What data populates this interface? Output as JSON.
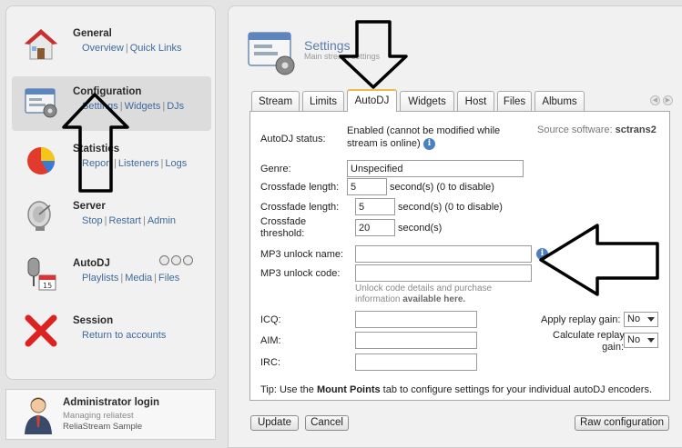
{
  "sidebar": {
    "items": [
      {
        "title": "General",
        "links": [
          "Overview",
          "Quick Links"
        ]
      },
      {
        "title": "Configuration",
        "links": [
          "Settings",
          "Widgets",
          "DJs"
        ]
      },
      {
        "title": "Statistics",
        "links": [
          "Report",
          "Listeners",
          "Logs"
        ]
      },
      {
        "title": "Server",
        "links": [
          "Stop",
          "Restart",
          "Admin"
        ]
      },
      {
        "title": "AutoDJ",
        "links": [
          "Playlists",
          "Media",
          "Files"
        ]
      },
      {
        "title": "Session",
        "links": [
          "Return to accounts"
        ]
      }
    ],
    "login": {
      "title": "Administrator login",
      "managing": "Managing reliatest",
      "product": "ReliaStream Sample"
    }
  },
  "header": {
    "title": "Settings",
    "subtitle": "Main stream settings"
  },
  "tabs": [
    "Stream",
    "Limits",
    "AutoDJ",
    "Widgets",
    "Host",
    "Files",
    "Albums"
  ],
  "active_tab": "AutoDJ",
  "form": {
    "autodj_status_label": "AutoDJ status:",
    "autodj_status_line1": "Enabled (cannot be modified while",
    "autodj_status_line2": "stream is online)",
    "source_software_label": "Source software:",
    "source_software_value": "sctrans2",
    "genre_label": "Genre:",
    "genre_value": "Unspecified",
    "crossfade_length_label": "Crossfade length:",
    "crossfade_length_value": "5",
    "crossfade_length_suffix": "second(s) (0 to disable)",
    "crossfade_length2_label": "Crossfade length:",
    "crossfade_length2_value": "5",
    "crossfade_length2_suffix": "second(s) (0 to disable)",
    "crossfade_threshold_label1": "Crossfade",
    "crossfade_threshold_label2": "threshold:",
    "crossfade_threshold_value": "20",
    "crossfade_threshold_suffix": "second(s)",
    "mp3_unlock_name_label": "MP3 unlock name:",
    "mp3_unlock_name_value": "",
    "mp3_unlock_code_label": "MP3 unlock code:",
    "mp3_unlock_code_value": "",
    "unlock_hint_line1": "Unlock code details and purchase",
    "unlock_hint_line2_prefix": "information ",
    "unlock_hint_line2_link": "available here.",
    "icq_label": "ICQ:",
    "icq_value": "",
    "aim_label": "AIM:",
    "aim_value": "",
    "irc_label": "IRC:",
    "irc_value": "",
    "apply_replay_gain_label": "Apply replay gain:",
    "apply_replay_gain_value": "No",
    "calc_replay_gain_label1": "Calculate replay",
    "calc_replay_gain_label2": "gain:",
    "calc_replay_gain_value": "No",
    "tip_prefix": "Tip: Use the ",
    "tip_bold": "Mount Points",
    "tip_suffix": " tab to configure settings for your individual autoDJ encoders."
  },
  "buttons": {
    "update": "Update",
    "cancel": "Cancel",
    "raw_configuration": "Raw configuration"
  }
}
